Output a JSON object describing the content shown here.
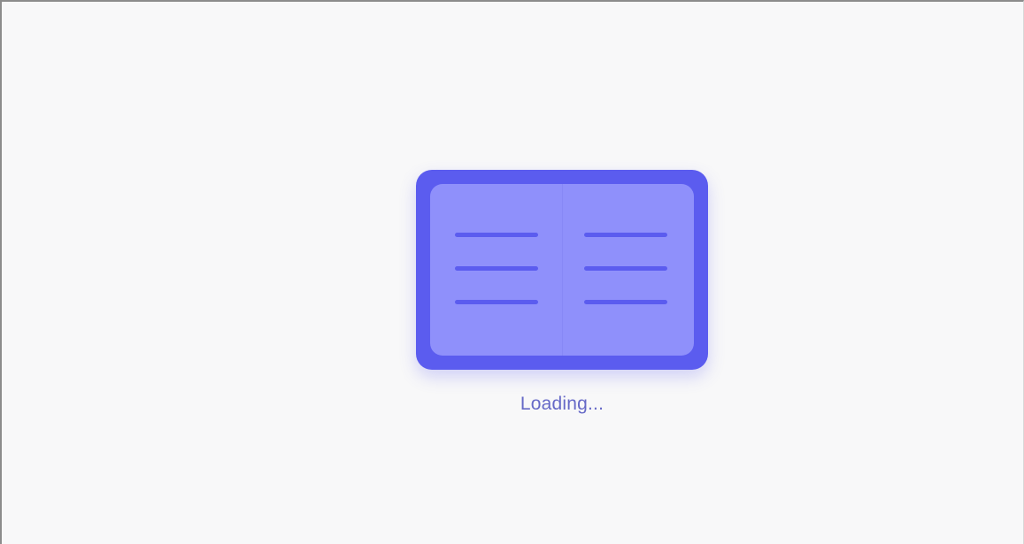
{
  "loader": {
    "icon": "open-book-icon",
    "status_text": "Loading..."
  },
  "colors": {
    "background": "#f8f8f9",
    "book_outer": "#5b5cef",
    "book_inner": "#8f90fb",
    "text": "#6669c7"
  }
}
